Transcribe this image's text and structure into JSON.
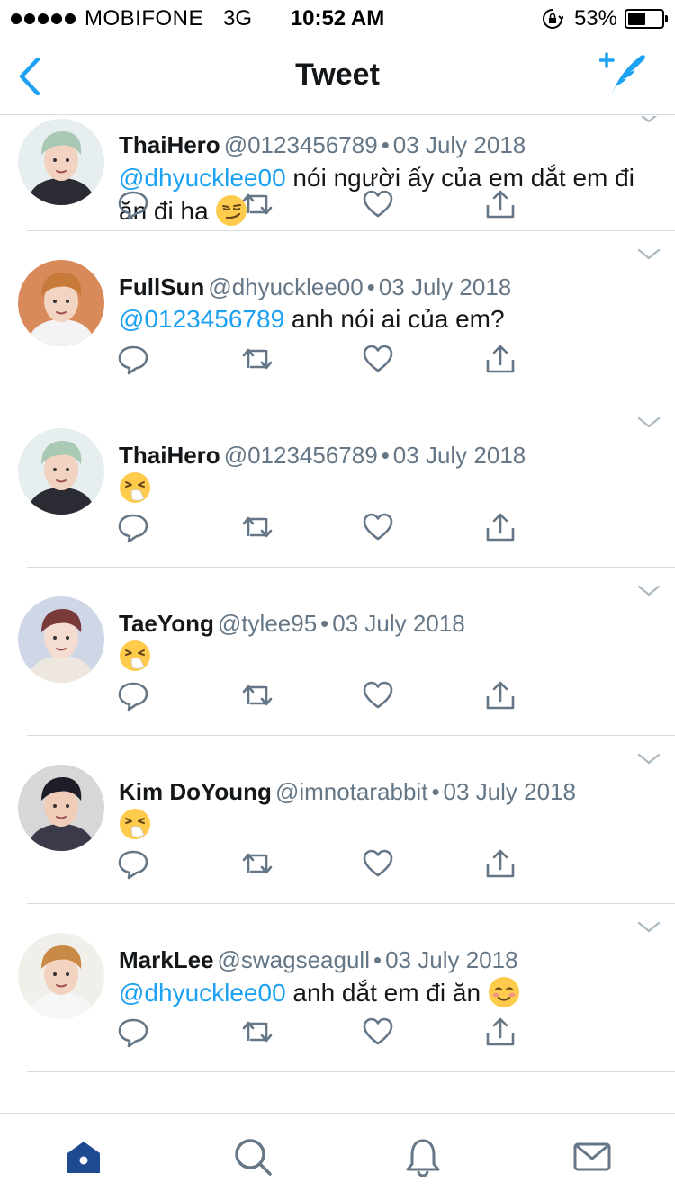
{
  "status_bar": {
    "carrier": "MOBIFONE",
    "network": "3G",
    "time": "10:52 AM",
    "battery_percent": "53%",
    "battery_level": 0.53
  },
  "nav": {
    "title": "Tweet",
    "back_icon": "chevron-left-icon",
    "compose_icon": "compose-tweet-icon"
  },
  "colors": {
    "accent": "#1da1f2",
    "text": "#14171a",
    "secondary": "#657786",
    "divider": "#d7dde2",
    "tab_active": "#1e4a8f"
  },
  "tweets": [
    {
      "name": "ThaiHero",
      "handle": "@0123456789",
      "sep": "•",
      "date": "03 July 2018",
      "mention": "@dhyucklee00",
      "text": " nói người ấy của em dắt em đi ăn đi ha ",
      "emoji": "smirking-face"
    },
    {
      "name": "FullSun",
      "handle": "@dhyucklee00",
      "sep": "•",
      "date": "03 July 2018",
      "mention": "@0123456789",
      "text": " anh nói ai của em?",
      "emoji": ""
    },
    {
      "name": "ThaiHero",
      "handle": "@0123456789",
      "sep": "•",
      "date": "03 July 2018",
      "mention": "",
      "text": "",
      "emoji": "sneezing-face"
    },
    {
      "name": "TaeYong",
      "handle": "@tylee95",
      "sep": "•",
      "date": "03 July 2018",
      "mention": "",
      "text": "",
      "emoji": "sneezing-face"
    },
    {
      "name": "Kim DoYoung",
      "handle": "@imnotarabbit",
      "sep": "•",
      "date": "03 July 2018",
      "mention": "",
      "text": "",
      "emoji": "sneezing-face"
    },
    {
      "name": "MarkLee",
      "handle": "@swagseagull",
      "sep": "•",
      "date": "03 July 2018",
      "mention": "@dhyucklee00",
      "text": " anh dắt em đi ăn ",
      "emoji": "smiling-face"
    }
  ],
  "tweet_actions": [
    "reply-icon",
    "retweet-icon",
    "like-icon",
    "share-icon"
  ],
  "tab_bar": [
    "home-icon",
    "search-icon",
    "notifications-icon",
    "messages-icon"
  ]
}
